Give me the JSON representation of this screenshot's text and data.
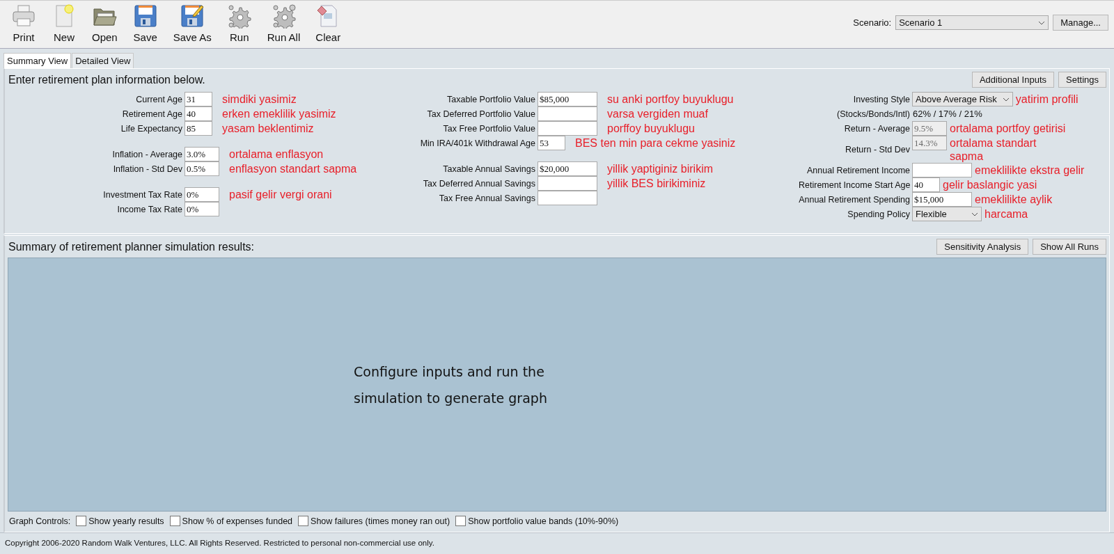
{
  "toolbar": {
    "buttons": [
      {
        "label": "Print"
      },
      {
        "label": "New"
      },
      {
        "label": "Open"
      },
      {
        "label": "Save"
      },
      {
        "label": "Save As"
      },
      {
        "label": "Run"
      },
      {
        "label": "Run All"
      },
      {
        "label": "Clear"
      }
    ],
    "scenario": {
      "label": "Scenario:",
      "value": "Scenario 1",
      "manage_button": "Manage..."
    }
  },
  "tabs": [
    {
      "label": "Summary View",
      "selected": true
    },
    {
      "label": "Detailed View",
      "selected": false
    }
  ],
  "inputs_panel": {
    "heading": "Enter retirement plan information below.",
    "buttons": [
      "Additional Inputs",
      "Settings"
    ],
    "columns": [
      [
        [
          {
            "label": "Current Age",
            "kind": "age_field",
            "value": "31",
            "note": "simdiki yasimiz"
          },
          {
            "label": "Retirement Age",
            "kind": "age_field",
            "value": "40",
            "note": "erken emeklilik yasimiz"
          },
          {
            "label": "Life Expectancy",
            "kind": "age_field",
            "value": "85",
            "note": "yasam beklentimiz"
          }
        ],
        [
          {
            "label": "Inflation - Average",
            "kind": "rate_field",
            "value": "3.0%",
            "note": "ortalama enflasyon"
          },
          {
            "label": "Inflation - Std Dev",
            "kind": "rate_field",
            "value": "0.5%",
            "note": "enflasyon standart sapma"
          }
        ],
        [
          {
            "label": "Investment Tax Rate",
            "kind": "rate_field",
            "value": "0%",
            "note": "pasif gelir vergi orani"
          },
          {
            "label": "Income Tax Rate",
            "kind": "rate_field",
            "value": "0%"
          }
        ]
      ],
      [
        [
          {
            "label": "Taxable Portfolio Value",
            "kind": "amount_field",
            "value": "$85,000",
            "note": "su anki portfoy buyuklugu"
          },
          {
            "label": "Tax Deferred Portfolio Value",
            "kind": "amount_field",
            "note": "varsa vergiden muaf"
          },
          {
            "label": "Tax Free Portfolio Value",
            "kind": "amount_field",
            "note": "porffoy buyuklugu"
          },
          {
            "label": "Min IRA/401k Withdrawal Age",
            "kind": "age_field",
            "value": "53",
            "note": "BES ten min para cekme yasiniz"
          }
        ],
        [
          {
            "label": "Taxable Annual Savings",
            "kind": "amount_field",
            "value": "$20,000",
            "note": "yillik yaptiginiz birikim"
          },
          {
            "label": "Tax Deferred Annual Savings",
            "kind": "amount_field",
            "note": "yillik BES birikiminiz"
          },
          {
            "label": "Tax Free Annual Savings",
            "kind": "amount_field"
          }
        ]
      ],
      [
        [
          {
            "label": "Investing Style",
            "kind": "dropdown",
            "value": "Above Average Risk",
            "note": "yatirim profili"
          },
          {
            "label": "(Stocks/Bonds/Intl)",
            "kind": "readout",
            "value": "62% / 17% / 21%"
          },
          {
            "label": "Return - Average",
            "kind": "rate_field",
            "value": "9.5%",
            "disabled": true,
            "note": "ortalama portfoy getirisi"
          },
          {
            "label": "Return - Std Dev",
            "kind": "rate_field",
            "value": "14.3%",
            "disabled": true,
            "note": "ortalama standart\nsapma"
          }
        ],
        [
          {
            "label": "Annual Retirement Income",
            "kind": "amount_field",
            "note": "emeklilikte ekstra gelir"
          },
          {
            "label": "Retirement Income Start Age",
            "kind": "age_field",
            "value": "40",
            "note": "gelir baslangic yasi"
          },
          {
            "label": "Annual Retirement Spending",
            "kind": "amount_field",
            "value": "$15,000",
            "note": "emeklilikte aylik"
          },
          {
            "label": "Spending Policy",
            "kind": "dropdown",
            "value": "Flexible",
            "note": "harcama"
          }
        ]
      ]
    ]
  },
  "results_panel": {
    "heading": "Summary of retirement planner simulation results:",
    "buttons": [
      "Sensitivity Analysis",
      "Show All Runs"
    ],
    "graph_message": "Configure inputs and run the simulation to generate graph",
    "graph_controls": {
      "label": "Graph Controls:",
      "options": [
        {
          "label": "Show yearly results",
          "checked": false
        },
        {
          "label": "Show % of expenses funded",
          "checked": false
        },
        {
          "label": "Show failures (times money ran out)",
          "checked": false
        },
        {
          "label": "Show portfolio value bands (10%-90%)",
          "checked": false
        }
      ]
    }
  },
  "status_bar": "Copyright 2006-2020 Random Walk Ventures, LLC.  All Rights Reserved.   Restricted to personal non-commercial use only."
}
